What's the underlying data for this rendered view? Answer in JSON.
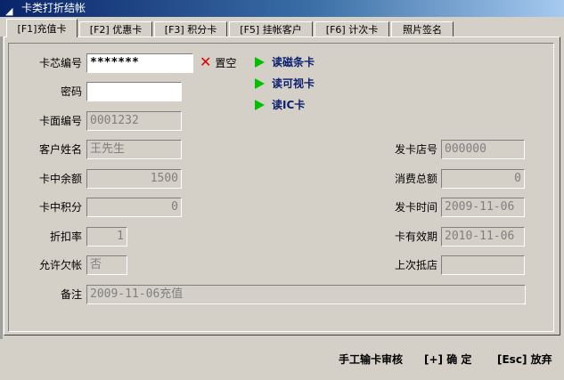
{
  "window": {
    "title": "卡类打折结帐",
    "icon": "arrow-icon"
  },
  "tabs": [
    {
      "label": "[F1]充值卡",
      "active": true
    },
    {
      "label": "[F2] 优惠卡"
    },
    {
      "label": "[F3] 积分卡"
    },
    {
      "label": "[F5] 挂帐客户"
    },
    {
      "label": "[F6] 计次卡"
    },
    {
      "label": "照片签名"
    }
  ],
  "form": {
    "card_chip_no": {
      "label": "卡芯编号",
      "value": "*******"
    },
    "password": {
      "label": "密码",
      "value": ""
    },
    "card_face_no": {
      "label": "卡面编号",
      "value": "0001232"
    },
    "customer_name": {
      "label": "客户姓名",
      "value": "王先生"
    },
    "balance": {
      "label": "卡中余额",
      "value": "1500"
    },
    "points": {
      "label": "卡中积分",
      "value": "0"
    },
    "discount": {
      "label": "折扣率",
      "value": "1"
    },
    "allow_debt": {
      "label": "允许欠帐",
      "value": "否"
    },
    "note": {
      "label": "备注",
      "value": "2009-11-06充值"
    },
    "issue_store": {
      "label": "发卡店号",
      "value": "000000"
    },
    "total_spent": {
      "label": "消费总额",
      "value": "0"
    },
    "issue_date": {
      "label": "发卡时间",
      "value": "2009-11-06"
    },
    "expiry": {
      "label": "卡有效期",
      "value": "2010-11-06"
    },
    "last_store": {
      "label": "上次抵店",
      "value": ""
    }
  },
  "actions": {
    "clear": "置空",
    "read_magstripe": "读磁条卡",
    "read_visible": "读可视卡",
    "read_ic": "读IC卡"
  },
  "footer": {
    "manual_audit": "手工输卡审核",
    "confirm": "[+] 确 定",
    "cancel": "[Esc] 放弃"
  }
}
